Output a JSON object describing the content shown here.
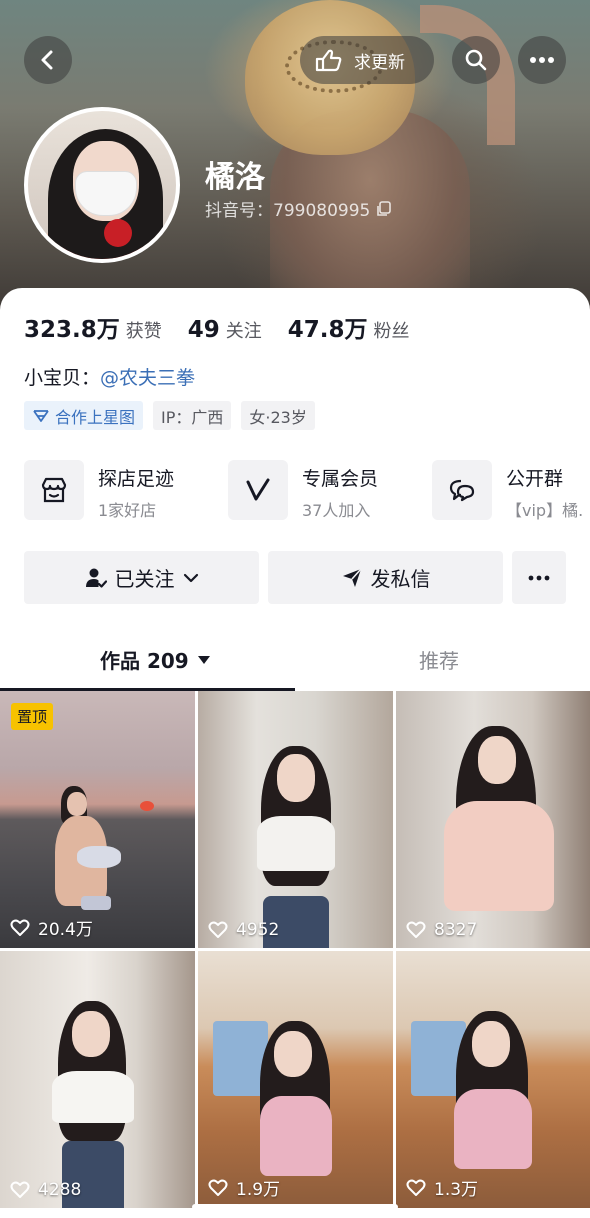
{
  "header": {
    "back_icon": "chevron-left-icon",
    "request_update_label": "求更新",
    "request_update_icon": "hand-pointer-icon",
    "search_icon": "search-icon",
    "more_icon": "more-dots-icon"
  },
  "profile": {
    "name": "橘洛",
    "douyin_id": "抖音号：799080995"
  },
  "stats": [
    {
      "value": "323.8万",
      "label": "获赞"
    },
    {
      "value": "49",
      "label": "关注"
    },
    {
      "value": "47.8万",
      "label": "粉丝"
    }
  ],
  "bio": {
    "prefix": "小宝贝：",
    "mention": "@农夫三拳"
  },
  "tags": [
    {
      "label": "合作上星图",
      "icon": "star-map-icon",
      "accent": "#3b72bf"
    },
    {
      "label": "IP：广西"
    },
    {
      "label": "女·23岁"
    }
  ],
  "services": [
    {
      "title": "探店足迹",
      "subtitle": "1家好店",
      "icon": "store-icon"
    },
    {
      "title": "专属会员",
      "subtitle": "37人加入",
      "icon": "vip-v-icon"
    },
    {
      "title": "公开群",
      "subtitle": "【vip】橘.",
      "icon": "chat-group-icon"
    }
  ],
  "actions": {
    "following_label": "已关注",
    "message_label": "发私信"
  },
  "tabs": {
    "works_label": "作品 209",
    "recommend_label": "推荐"
  },
  "videos": [
    {
      "likes": "20.4万",
      "pinned_label": "置顶"
    },
    {
      "likes": "4952"
    },
    {
      "likes": "8327"
    },
    {
      "likes": "4288"
    },
    {
      "likes": "1.9万"
    },
    {
      "likes": "1.3万"
    }
  ]
}
